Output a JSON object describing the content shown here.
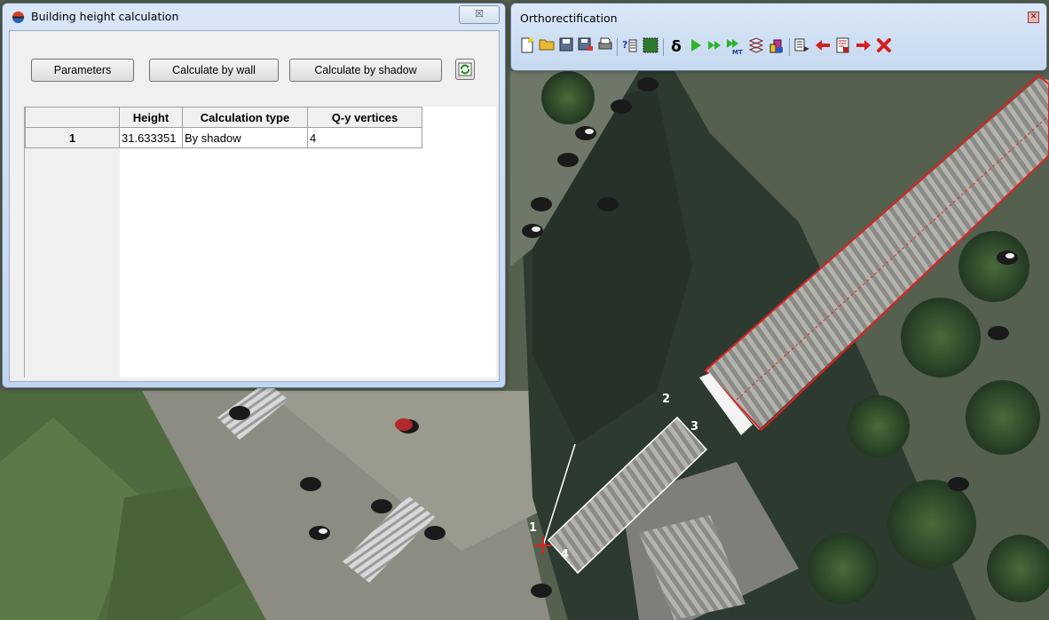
{
  "building_height_window": {
    "title": "Building height calculation",
    "buttons": {
      "parameters": "Parameters",
      "calc_by_wall": "Calculate by wall",
      "calc_by_shadow": "Calculate by shadow",
      "refresh_icon": "refresh-icon"
    },
    "close_glyph": "☒",
    "table": {
      "headers": [
        "",
        "Height",
        "Calculation type",
        "Q-y  vertices"
      ],
      "rows": [
        {
          "index": "1",
          "height": "31.633351",
          "type": "By shadow",
          "vertices": "4"
        }
      ]
    }
  },
  "ortho_window": {
    "title": "Orthorectification",
    "toolbar_icons": [
      "new-icon",
      "open-icon",
      "save-icon",
      "save-as-icon",
      "print-icon",
      "settings-icon",
      "grid-icon",
      "delta-icon",
      "run-icon",
      "run-fast-icon",
      "run-mt-icon",
      "mosaic-icon",
      "building-icon",
      "export-icon",
      "arrow-left-icon",
      "report-icon",
      "arrow-right-icon",
      "delete-icon"
    ],
    "delta_glyph": "δ"
  },
  "map_labels": {
    "vertex_1": "1",
    "vertex_2": "2",
    "vertex_3": "3",
    "vertex_4": "4"
  },
  "colors": {
    "outline_red": "#e02020",
    "outline_white": "#ffffff",
    "title_bg": "#c9daf0"
  }
}
